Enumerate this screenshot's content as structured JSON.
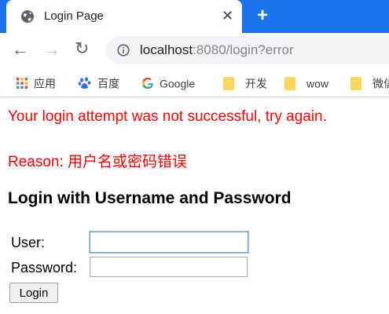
{
  "tab": {
    "title": "Login Page",
    "close": "✕",
    "new_tab": "+"
  },
  "toolbar": {
    "back": "←",
    "forward": "→",
    "reload": "↻",
    "url_host": "localhost",
    "url_rest": ":8080/login?error"
  },
  "bookmarks": [
    {
      "label": "应用",
      "icon": "apps-grid-icon"
    },
    {
      "label": "百度",
      "icon": "baidu-paw-icon"
    },
    {
      "label": "Google",
      "icon": "google-g-icon"
    },
    {
      "label": "开发",
      "icon": "folder-icon"
    },
    {
      "label": "wow",
      "icon": "folder-icon"
    },
    {
      "label": "微信",
      "icon": "folder-icon"
    }
  ],
  "page": {
    "error_message": "Your login attempt was not successful, try again.",
    "error_reason": "Reason: 用户名或密码错误",
    "heading": "Login with Username and Password",
    "user_label": "User:",
    "password_label": "Password:",
    "user_value": "",
    "password_value": "",
    "login_button": "Login"
  },
  "colors": {
    "tabbar": "#1a73e8",
    "error": "#ff0000",
    "omnibox": "#f1f3f4"
  }
}
